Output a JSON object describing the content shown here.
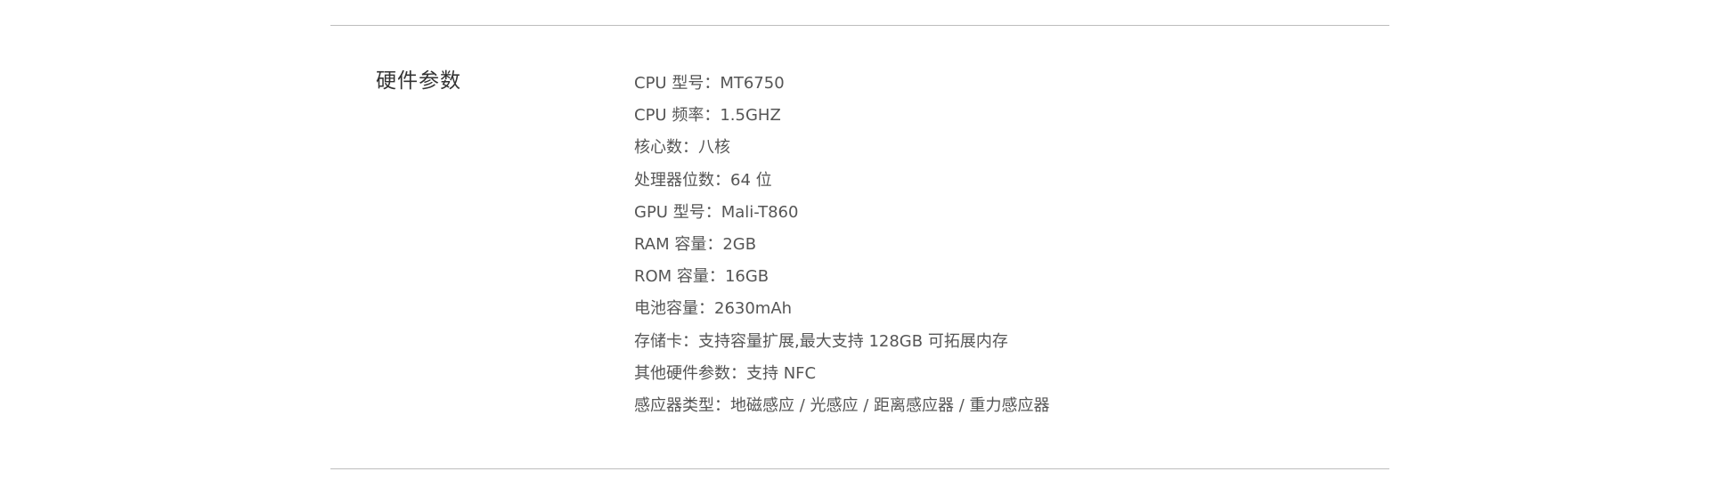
{
  "section": {
    "title": "硬件参数"
  },
  "specs": [
    {
      "label": "CPU 型号：",
      "value": "MT6750"
    },
    {
      "label": "CPU 频率：",
      "value": "1.5GHZ"
    },
    {
      "label": "核心数：",
      "value": "八核"
    },
    {
      "label": "处理器位数：",
      "value": "64 位"
    },
    {
      "label": "GPU 型号：",
      "value": "Mali-T860"
    },
    {
      "label": "RAM 容量：",
      "value": "2GB"
    },
    {
      "label": "ROM 容量：",
      "value": "16GB"
    },
    {
      "label": "电池容量：",
      "value": "2630mAh"
    },
    {
      "label": "存储卡：",
      "value": "支持容量扩展,最大支持 128GB 可拓展内存"
    },
    {
      "label": "其他硬件参数：",
      "value": "支持 NFC"
    },
    {
      "label": "感应器类型：",
      "value": "地磁感应 / 光感应 / 距离感应器 / 重力感应器"
    }
  ]
}
